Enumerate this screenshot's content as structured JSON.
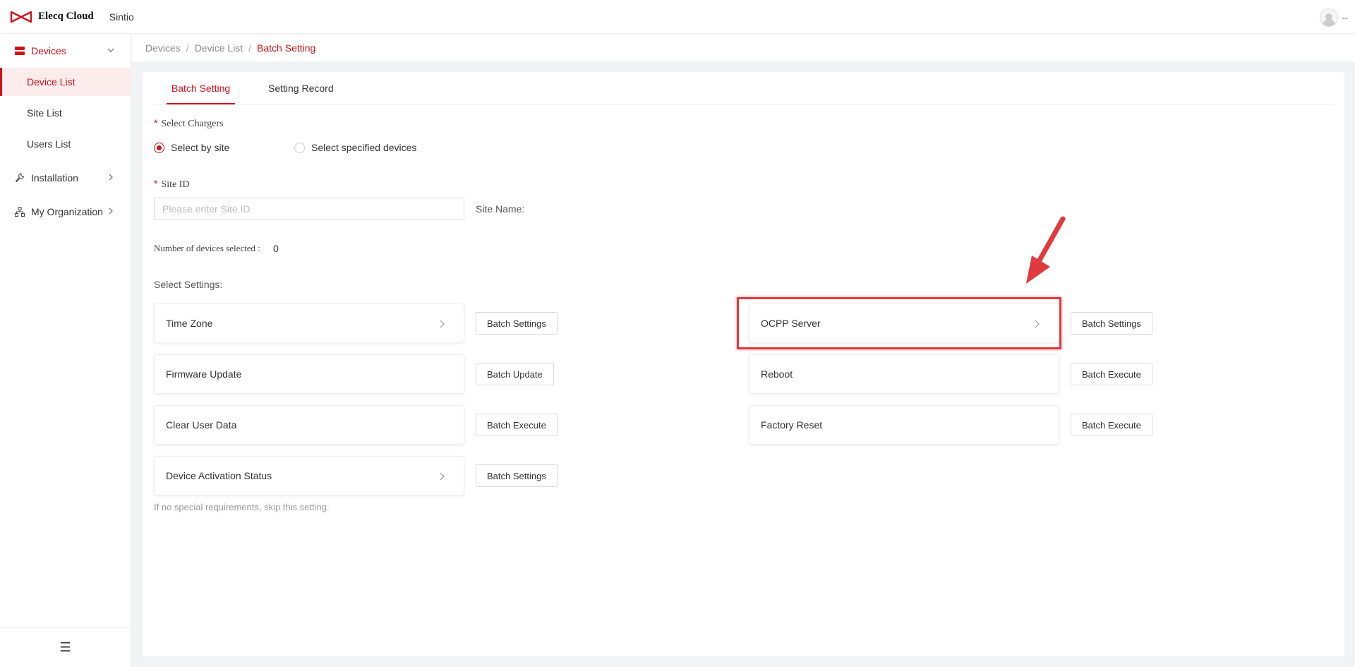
{
  "header": {
    "brand": "Elecq Cloud",
    "org": "Sintio",
    "user": "--"
  },
  "sidebar": {
    "groups": [
      {
        "label": "Devices",
        "items": [
          "Device List",
          "Site List",
          "Users List"
        ]
      },
      {
        "label": "Installation"
      },
      {
        "label": "My Organization"
      }
    ],
    "footer_icon": "☰"
  },
  "breadcrumb": [
    "Devices",
    "Device List",
    "Batch Setting"
  ],
  "breadcrumb_sep": "/",
  "tabs": [
    "Batch Setting",
    "Setting Record"
  ],
  "form": {
    "chargers_label": "Select Chargers",
    "required_mark": "*",
    "radio_options": [
      "Select by site",
      "Select specified devices"
    ],
    "site_id_label": "Site ID",
    "site_id_placeholder": "Please enter Site ID",
    "site_id_value": "",
    "site_name_label": "Site Name:",
    "devices_selected_label": "Number of devices selected :",
    "devices_selected_value": "0",
    "select_settings_label": "Select Settings:",
    "hint": "If no special requirements, skip this setting."
  },
  "settings": [
    {
      "label": "Time Zone",
      "button": "Batch Settings"
    },
    {
      "label": "Firmware Update",
      "button": "Batch Update"
    },
    {
      "label": "Clear User Data",
      "button": "Batch Execute"
    },
    {
      "label": "Device Activation Status",
      "button": "Batch Settings"
    },
    {
      "label": "OCPP Server",
      "button": "Batch Settings"
    },
    {
      "label": "Reboot",
      "button": "Batch Execute"
    },
    {
      "label": "Factory Reset",
      "button": "Batch Execute"
    }
  ],
  "colors": {
    "accent": "#d0121b",
    "annotation": "#e03a3e"
  }
}
